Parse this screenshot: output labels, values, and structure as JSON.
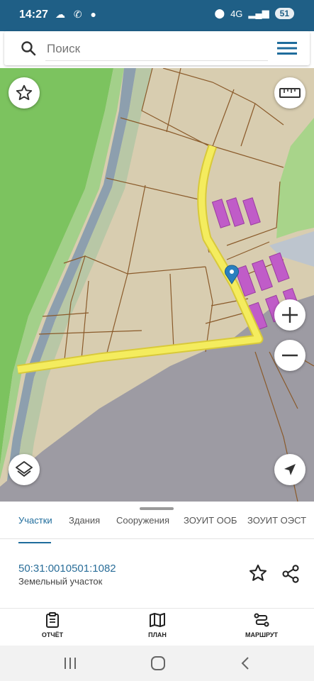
{
  "status_bar": {
    "time": "14:27",
    "battery": "51",
    "signal": "4G"
  },
  "search": {
    "placeholder": "Поиск"
  },
  "tabs": [
    {
      "label": "Участки",
      "active": true
    },
    {
      "label": "Здания",
      "active": false
    },
    {
      "label": "Сооружения",
      "active": false
    },
    {
      "label": "ЗОУИТ ООБ",
      "active": false
    },
    {
      "label": "ЗОУИТ ОЭСТ",
      "active": false
    }
  ],
  "parcel": {
    "cadastral_number": "50:31:0010501:1082",
    "type": "Земельный участок"
  },
  "bottom_nav": [
    {
      "label": "ОТЧЁТ",
      "icon": "clipboard-icon"
    },
    {
      "label": "ПЛАН",
      "icon": "map-icon"
    },
    {
      "label": "МАРШРУТ",
      "icon": "route-icon"
    }
  ],
  "colors": {
    "accent": "#1f6c9c",
    "status_bar": "#1f5f86",
    "route": "#f2ea5a",
    "building": "#c05cc8",
    "forest": "#76c05a"
  }
}
